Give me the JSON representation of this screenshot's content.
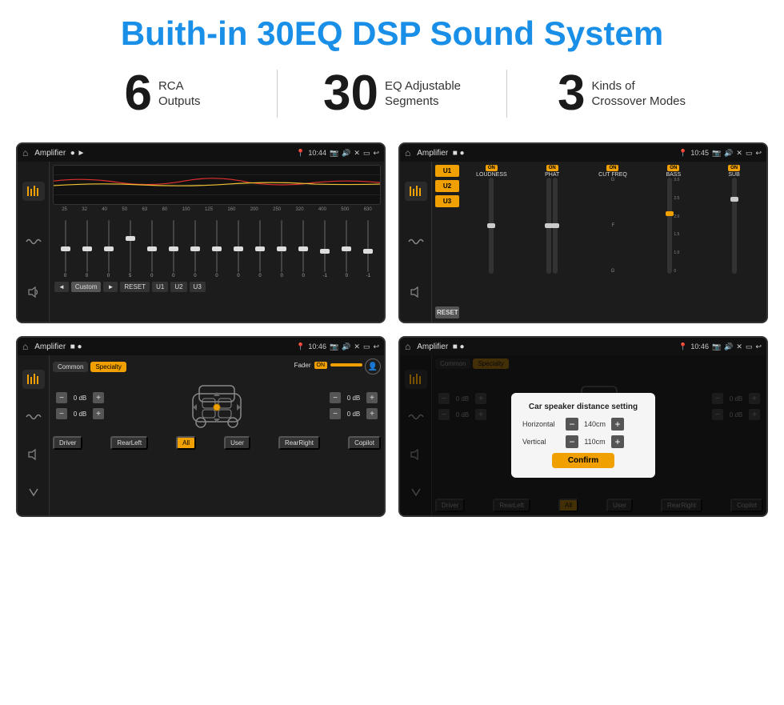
{
  "header": {
    "title": "Buith-in 30EQ DSP Sound System"
  },
  "stats": [
    {
      "number": "6",
      "label": "RCA\nOutputs"
    },
    {
      "number": "30",
      "label": "EQ Adjustable\nSegments"
    },
    {
      "number": "3",
      "label": "Kinds of\nCrossover Modes"
    }
  ],
  "screens": [
    {
      "id": "eq-screen",
      "statusBar": {
        "title": "Amplifier",
        "time": "10:44"
      },
      "type": "eq"
    },
    {
      "id": "amp-screen",
      "statusBar": {
        "title": "Amplifier",
        "time": "10:45"
      },
      "type": "amplifier"
    },
    {
      "id": "crossover-screen",
      "statusBar": {
        "title": "Amplifier",
        "time": "10:46"
      },
      "type": "crossover"
    },
    {
      "id": "dialog-screen",
      "statusBar": {
        "title": "Amplifier",
        "time": "10:46"
      },
      "type": "dialog"
    }
  ],
  "eq": {
    "frequencies": [
      "25",
      "32",
      "40",
      "50",
      "63",
      "80",
      "100",
      "125",
      "160",
      "200",
      "250",
      "320",
      "400",
      "500",
      "630"
    ],
    "values": [
      "0",
      "0",
      "0",
      "5",
      "0",
      "0",
      "0",
      "0",
      "0",
      "0",
      "0",
      "0",
      "-1",
      "0",
      "-1"
    ],
    "controls": [
      "◄",
      "Custom",
      "►",
      "RESET",
      "U1",
      "U2",
      "U3"
    ]
  },
  "amplifier": {
    "presets": [
      "U1",
      "U2",
      "U3"
    ],
    "channels": [
      {
        "name": "LOUDNESS",
        "on": true
      },
      {
        "name": "PHAT",
        "on": true
      },
      {
        "name": "CUT FREQ",
        "on": true
      },
      {
        "name": "BASS",
        "on": true
      },
      {
        "name": "SUB",
        "on": true
      }
    ],
    "resetBtn": "RESET"
  },
  "crossover": {
    "tabs": [
      "Common",
      "Specialty"
    ],
    "activeTab": "Specialty",
    "faderLabel": "Fader",
    "faderOn": "ON",
    "dbValues": [
      "0 dB",
      "0 dB",
      "0 dB",
      "0 dB"
    ],
    "bottomBtns": [
      "Driver",
      "RearLeft",
      "All",
      "User",
      "RearRight",
      "Copilot"
    ]
  },
  "dialog": {
    "title": "Car speaker distance setting",
    "horizontal": {
      "label": "Horizontal",
      "value": "140cm"
    },
    "vertical": {
      "label": "Vertical",
      "value": "110cm"
    },
    "confirmLabel": "Confirm",
    "tabs": [
      "Common",
      "Specialty"
    ],
    "activeTab": "Specialty",
    "dbValues": [
      "0 dB",
      "0 dB"
    ],
    "bottomBtns": [
      "Driver",
      "RearLeft",
      "All",
      "User",
      "RearRight",
      "Copilot"
    ]
  }
}
